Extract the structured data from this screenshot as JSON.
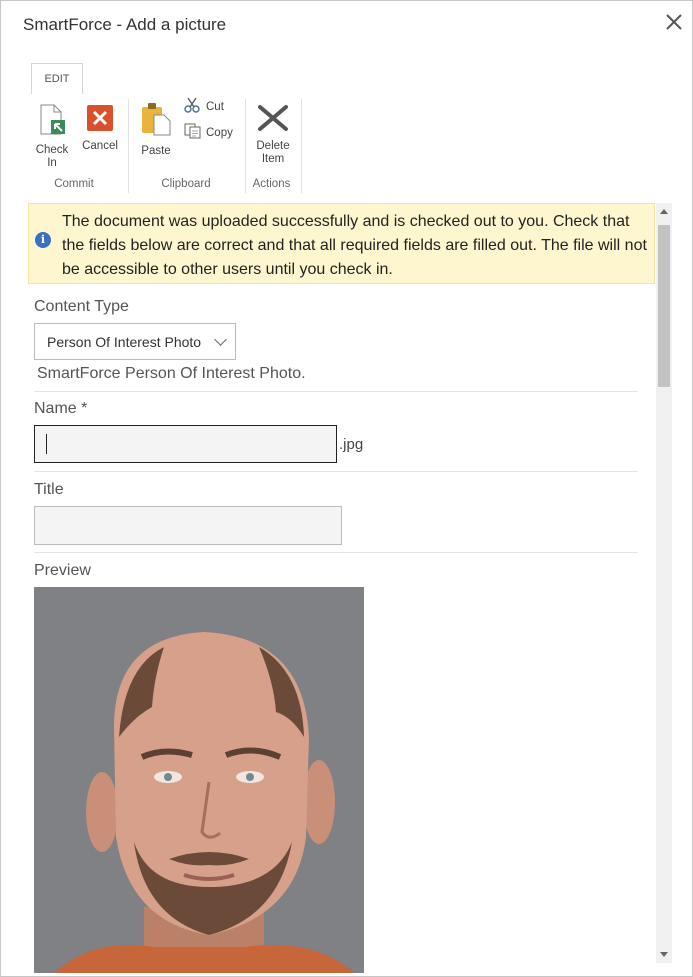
{
  "dialog": {
    "title": "SmartForce - Add a picture",
    "close_icon": "close-icon"
  },
  "ribbon": {
    "tab_label": "EDIT",
    "check_in_label": "Check\nIn",
    "cancel_label": "Cancel",
    "paste_label": "Paste",
    "cut_label": "Cut",
    "copy_label": "Copy",
    "delete_label": "Delete\nItem",
    "groups": {
      "commit": "Commit",
      "clipboard": "Clipboard",
      "actions": "Actions"
    },
    "colors": {
      "cancel_red": "#d9502c",
      "checkin_green": "#3b8c5a",
      "paste_gold": "#e8b43c"
    }
  },
  "notice": {
    "icon": "info-icon",
    "text": "The document was uploaded successfully and is checked out to you. Check that the fields below are correct and that all required fields are filled out. The file will not be accessible to other users until you check in."
  },
  "form": {
    "content_type_label": "Content Type",
    "content_type_value": "Person Of Interest Photo",
    "content_type_desc": "SmartForce Person Of Interest Photo.",
    "name_label": "Name *",
    "name_value": "",
    "name_suffix": ".jpg",
    "title_label": "Title",
    "title_value": "",
    "preview_label": "Preview"
  }
}
